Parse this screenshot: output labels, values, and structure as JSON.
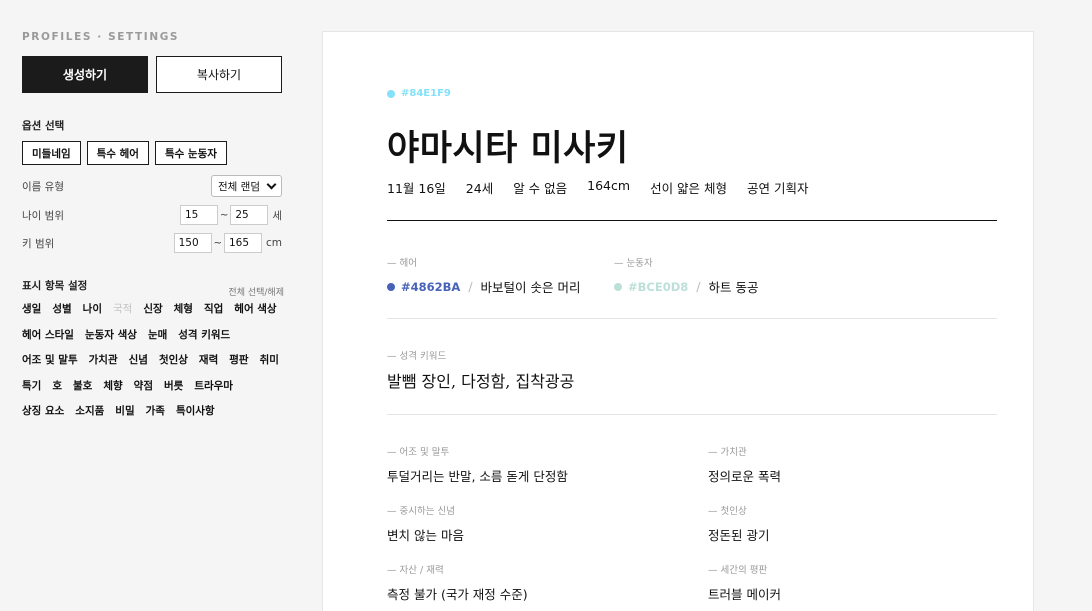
{
  "sidebar": {
    "brand": "PROFILES · SETTINGS",
    "generate_label": "생성하기",
    "copy_label": "복사하기",
    "options_title": "옵션 선택",
    "chips": [
      "미들네임",
      "특수 헤어",
      "특수 눈동자"
    ],
    "name_type_label": "이름 유형",
    "name_type_value": "전체 랜덤",
    "age_label": "나이 범위",
    "age_min": "15",
    "age_max": "25",
    "age_unit": "세",
    "height_label": "키 범위",
    "height_min": "150",
    "height_max": "165",
    "height_unit": "cm",
    "display_title": "표시 항목 설정",
    "select_all": "전체 선택/해제",
    "toggles": [
      {
        "label": "생일",
        "on": true
      },
      {
        "label": "성별",
        "on": true
      },
      {
        "label": "나이",
        "on": true
      },
      {
        "label": "국적",
        "on": false
      },
      {
        "label": "신장",
        "on": true
      },
      {
        "label": "체형",
        "on": true
      },
      {
        "label": "직업",
        "on": true
      },
      {
        "label": "헤어 색상",
        "on": true
      },
      {
        "label": "헤어 스타일",
        "on": true
      },
      {
        "label": "눈동자 색상",
        "on": true
      },
      {
        "label": "눈매",
        "on": true
      },
      {
        "label": "성격 키워드",
        "on": true
      },
      {
        "label": "어조 및 말투",
        "on": true
      },
      {
        "label": "가치관",
        "on": true
      },
      {
        "label": "신념",
        "on": true
      },
      {
        "label": "첫인상",
        "on": true
      },
      {
        "label": "재력",
        "on": true
      },
      {
        "label": "평판",
        "on": true
      },
      {
        "label": "취미",
        "on": true
      },
      {
        "label": "특기",
        "on": true
      },
      {
        "label": "호",
        "on": true
      },
      {
        "label": "불호",
        "on": true
      },
      {
        "label": "체향",
        "on": true
      },
      {
        "label": "약점",
        "on": true
      },
      {
        "label": "버릇",
        "on": true
      },
      {
        "label": "트라우마",
        "on": true
      },
      {
        "label": "상징 요소",
        "on": true
      },
      {
        "label": "소지품",
        "on": true
      },
      {
        "label": "비밀",
        "on": true
      },
      {
        "label": "가족",
        "on": true
      },
      {
        "label": "특이사항",
        "on": true
      }
    ]
  },
  "profile": {
    "theme_hex": "#84E1F9",
    "name": "야마시타 미사키",
    "meta": [
      "11월 16일",
      "24세",
      "알 수 없음",
      "164cm",
      "선이 얇은 체형",
      "공연 기획자"
    ],
    "hair": {
      "label": "헤어",
      "hex": "#4862BA",
      "desc": "바보털이 솟은 머리",
      "color": "#4862BA"
    },
    "eyes": {
      "label": "눈동자",
      "hex": "#BCE0D8",
      "desc": "하트 동공",
      "color": "#BCE0D8"
    },
    "keywords_label": "성격 키워드",
    "keywords": "발뺌 장인, 다정함, 집착광공",
    "details": [
      {
        "label": "어조 및 말투",
        "value": "투덜거리는 반말, 소름 돋게 단정함"
      },
      {
        "label": "가치관",
        "value": "정의로운 폭력"
      },
      {
        "label": "중시하는 신념",
        "value": "변치 않는 마음"
      },
      {
        "label": "첫인상",
        "value": "정돈된 광기"
      },
      {
        "label": "자산 / 재력",
        "value": "측정 불가 (국가 재정 수준)"
      },
      {
        "label": "세간의 평판",
        "value": "트러블 메이커"
      }
    ]
  },
  "colors": {
    "accent_dark": "#1b1b1b",
    "page_bg": "#f5f5f5"
  }
}
